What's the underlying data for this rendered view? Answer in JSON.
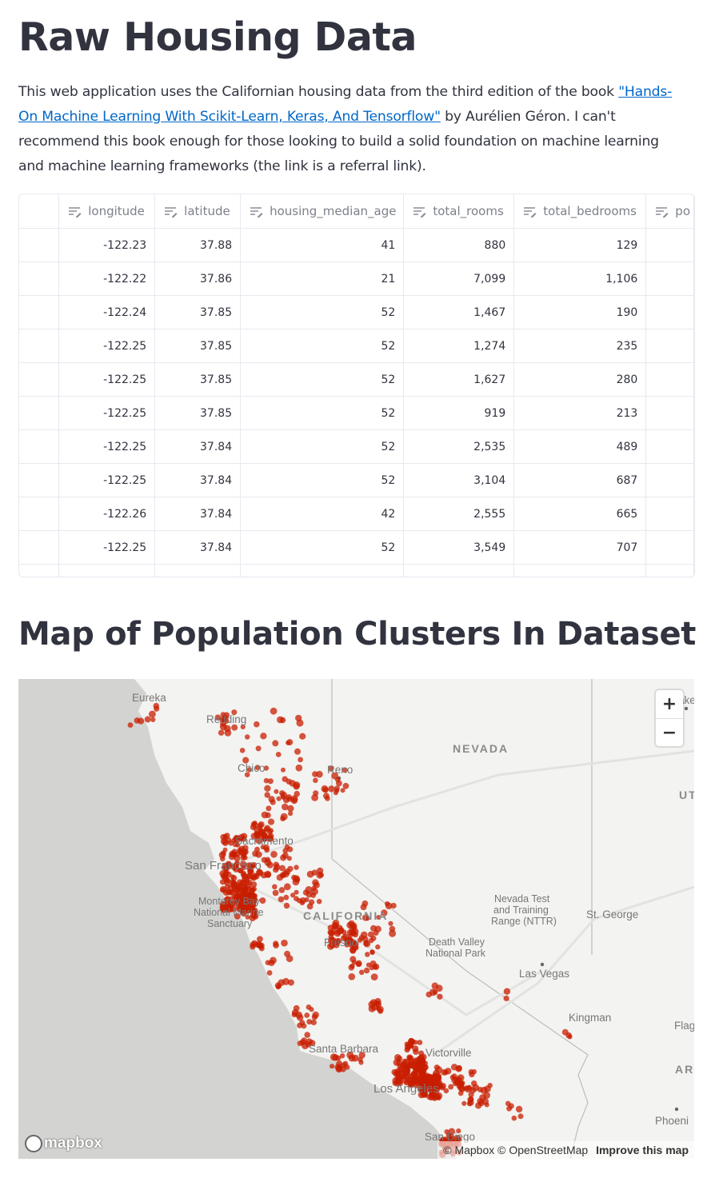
{
  "page": {
    "title": "Raw Housing Data",
    "intro_before_link": "This web application uses the Californian housing data from the third edition of the book ",
    "intro_link": "\"Hands-On Machine Learning With Scikit-Learn, Keras, And Tensorflow\"",
    "intro_after_link": " by Aurélien Géron. I can't recommend this book enough for those looking to build a solid foundation on machine learning and machine learning frameworks (the link is a referral link).",
    "map_heading": "Map of Population Clusters In Dataset"
  },
  "table": {
    "columns": [
      "longitude",
      "latitude",
      "housing_median_age",
      "total_rooms",
      "total_bedrooms",
      "po"
    ],
    "rows": [
      [
        "-122.23",
        "37.88",
        "41",
        "880",
        "129"
      ],
      [
        "-122.22",
        "37.86",
        "21",
        "7,099",
        "1,106"
      ],
      [
        "-122.24",
        "37.85",
        "52",
        "1,467",
        "190"
      ],
      [
        "-122.25",
        "37.85",
        "52",
        "1,274",
        "235"
      ],
      [
        "-122.25",
        "37.85",
        "52",
        "1,627",
        "280"
      ],
      [
        "-122.25",
        "37.85",
        "52",
        "919",
        "213"
      ],
      [
        "-122.25",
        "37.84",
        "52",
        "2,535",
        "489"
      ],
      [
        "-122.25",
        "37.84",
        "52",
        "3,104",
        "687"
      ],
      [
        "-122.26",
        "37.84",
        "42",
        "2,555",
        "665"
      ],
      [
        "-122.25",
        "37.84",
        "52",
        "3,549",
        "707"
      ]
    ]
  },
  "map": {
    "labels": {
      "eureka": "Eureka",
      "redding": "Redding",
      "chico": "Chico",
      "reno": "Reno",
      "nevada": "NEVADA",
      "ut": "UT",
      "sacramento": "Sacramento",
      "san_francisco": "San Francisco",
      "california": "CALIFORNIA",
      "monterey_1": "Monterey Bay",
      "monterey_2": "National Marine",
      "monterey_3": "Sanctuary",
      "fresno": "Fresno",
      "nevada_test_1": "Nevada Test",
      "nevada_test_2": "and Training",
      "nevada_test_3": "Range (NTTR)",
      "st_george": "St. George",
      "death_valley_1": "Death Valley",
      "death_valley_2": "National Park",
      "las_vegas": "Las Vegas",
      "kingman": "Kingman",
      "flag": "Flag",
      "santa_barbara": "Santa Barbara",
      "victorville": "Victorville",
      "los_angeles": "Los Angeles",
      "ar": "AR",
      "phoenix": "Phoeni",
      "san_diego": "San Diego",
      "lake": "ake"
    },
    "zoom_in": "+",
    "zoom_out": "−",
    "logo_text": "mapbox",
    "attrib_mapbox": "© Mapbox",
    "attrib_osm": "© OpenStreetMap",
    "attrib_improve": "Improve this map",
    "point_color": "#c81e00"
  }
}
